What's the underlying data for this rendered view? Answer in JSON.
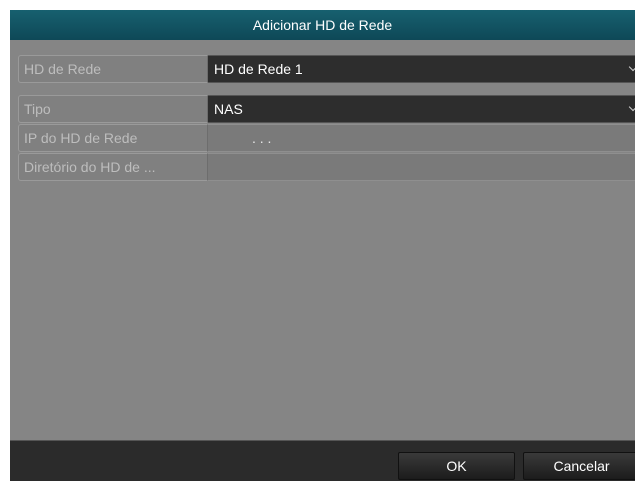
{
  "dialog": {
    "title": "Adicionar HD de Rede"
  },
  "fields": {
    "network_hd": {
      "label": "HD de Rede",
      "value": "HD de Rede 1"
    },
    "type": {
      "label": "Tipo",
      "value": "NAS"
    },
    "ip": {
      "label": "IP do HD de Rede",
      "value": ".   .   ."
    },
    "directory": {
      "label": "Diretório do HD de ...",
      "value": ""
    }
  },
  "buttons": {
    "ok": "OK",
    "cancel": "Cancelar"
  },
  "colors": {
    "titlebar": "#0e4857",
    "panel": "#858585",
    "footer": "#2b2b2b"
  }
}
